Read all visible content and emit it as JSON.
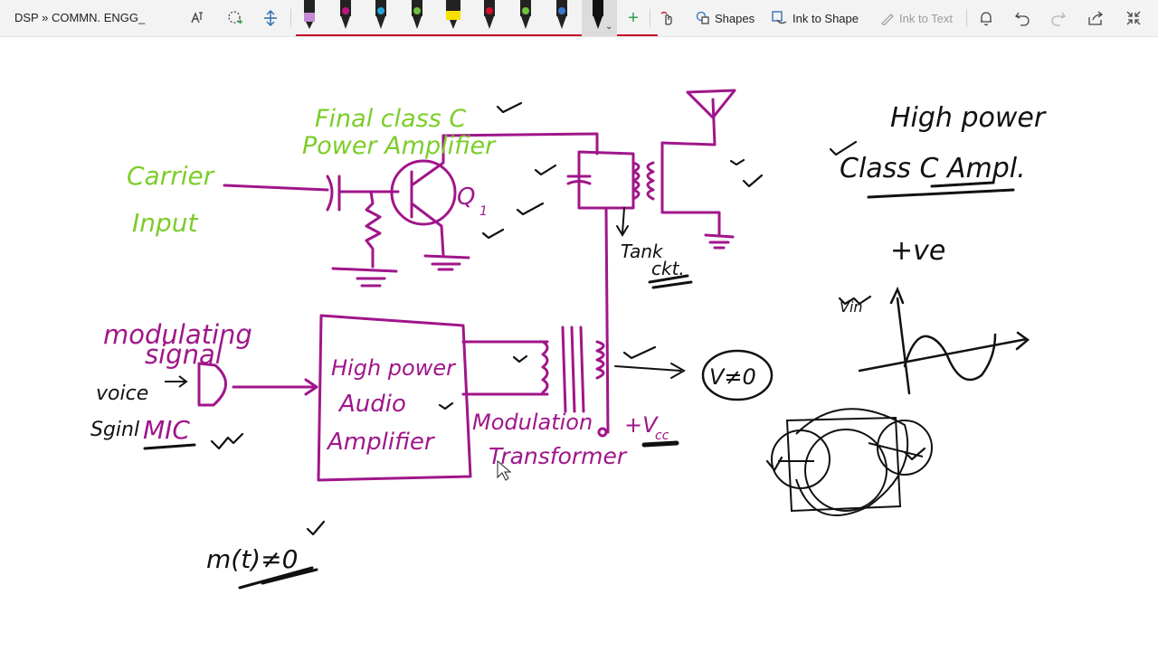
{
  "breadcrumb": "DSP » COMMN. ENGG_",
  "toolbar": {
    "shapes_label": "Shapes",
    "ink_to_shape_label": "Ink to Shape",
    "ink_to_text_label": "Ink to Text",
    "icons": [
      "ink-to-text-icon",
      "lasso-select-icon",
      "add-space-icon",
      "add-pen-icon",
      "touch-drawing-icon",
      "bell-icon",
      "undo-icon",
      "redo-icon",
      "share-icon",
      "full-screen-icon"
    ]
  },
  "colors": {
    "magenta_ink": "#a0168a",
    "green_ink": "#7ccd2a",
    "black_ink": "#111111",
    "pens": [
      "#c58ad6",
      "#c0157f",
      "#24a7d8",
      "#6fbf3a",
      "#f5e100",
      "#d5102a",
      "#6ec23c",
      "#3c77c9",
      "#111111"
    ]
  },
  "notes": {
    "final_class_c": "Final class C",
    "power_amplifier": "Power Amplifier",
    "carrier": "Carrier",
    "input": "Input",
    "q1": "Q",
    "q1_sub": "1",
    "tank": "Tank",
    "ckt": "ckt.",
    "high_power": "High power",
    "class_c_ampl": "Class C Ampl.",
    "plus_ve": "+ve",
    "vin": "Vin",
    "modulating": "modulating",
    "signal": "signal",
    "voice": "voice",
    "signal2": "Sginl",
    "mic": "MIC",
    "box_line1": "High power",
    "box_line2": "Audio",
    "box_line3": "Amplifier",
    "modulation": "Modulation",
    "transformer": "Transformer",
    "vcc": "+V",
    "vcc_sub": "cc",
    "v_ne_0": "V≠0",
    "m_t_ne_0": "m(t)≠0"
  }
}
